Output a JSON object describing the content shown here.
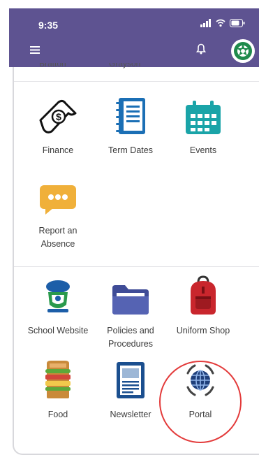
{
  "status_bar": {
    "time": "9:35"
  },
  "header": {
    "menu_icon": "hamburger-icon",
    "bell_icon": "bell-icon",
    "avatar_icon": "school-logo-icon",
    "background": "#5e5391"
  },
  "partial_labels": {
    "left": "Bratton",
    "right": "Grayson"
  },
  "tiles": [
    {
      "label": "Finance",
      "icon": "money-icon"
    },
    {
      "label": "Term Dates",
      "icon": "notebook-icon"
    },
    {
      "label": "Events",
      "icon": "calendar-icon"
    },
    {
      "label": "Report an Absence",
      "icon": "chat-bubble-icon"
    },
    {
      "label": "School Website",
      "icon": "school-crest-icon"
    },
    {
      "label": "Policies and Procedures",
      "icon": "folder-icon"
    },
    {
      "label": "Uniform Shop",
      "icon": "backpack-icon"
    },
    {
      "label": "Food",
      "icon": "sandwich-icon"
    },
    {
      "label": "Newsletter",
      "icon": "newspaper-icon"
    },
    {
      "label": "Portal",
      "icon": "globe-portal-icon"
    }
  ],
  "highlight_color": "#e33b3b"
}
